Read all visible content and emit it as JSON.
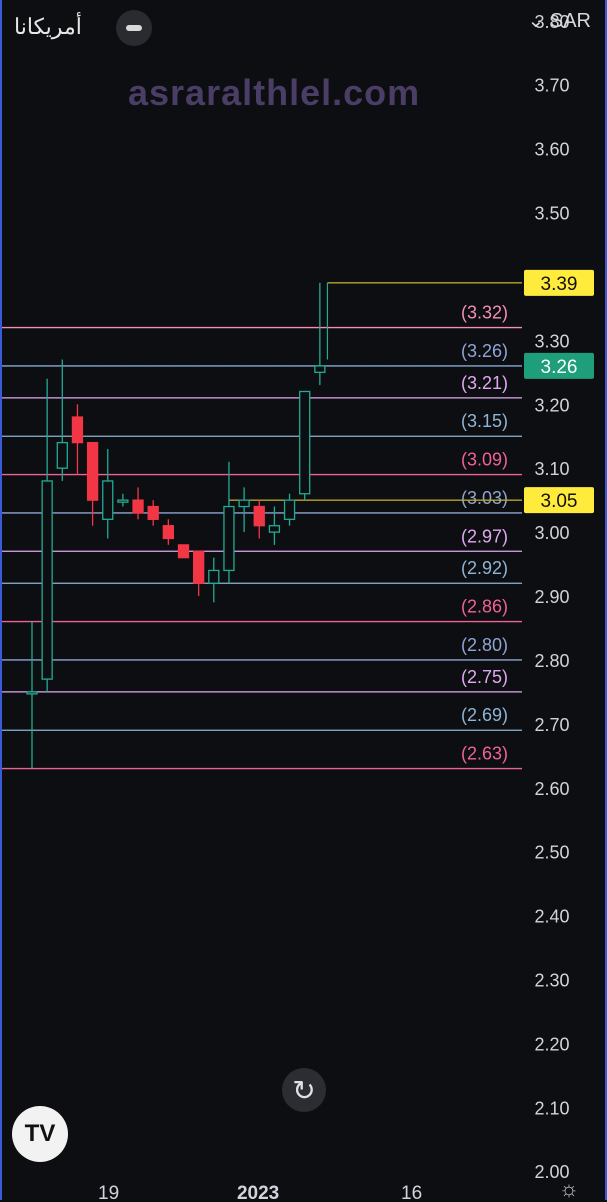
{
  "header": {
    "title": "أمريكانا",
    "currency": "SAR",
    "currency_chevron": "⌄",
    "watermark": "asraralthlel.com"
  },
  "icons": {
    "collapse": "minus-icon",
    "reset": "reset-icon",
    "logo": "tradingview-logo",
    "settings": "settings-icon"
  },
  "logo_text": "TV",
  "reset_glyph": "↻",
  "settings_glyph": "☼",
  "chart_data": {
    "type": "candlestick",
    "y_ticks": [
      "3.80",
      "3.70",
      "3.60",
      "3.50",
      "3.30",
      "3.20",
      "3.10",
      "3.00",
      "2.90",
      "2.80",
      "2.70",
      "2.60",
      "2.50",
      "2.40",
      "2.30",
      "2.20",
      "2.10",
      "2.00"
    ],
    "ylim": [
      1.955,
      3.82
    ],
    "x_labels": [
      {
        "label": "19",
        "index": 4
      },
      {
        "label": "2023",
        "index": 14
      },
      {
        "label": "16",
        "index": 24
      }
    ],
    "candles": [
      {
        "o": 2.75,
        "h": 2.86,
        "l": 2.63,
        "c": 2.75
      },
      {
        "o": 2.77,
        "h": 3.24,
        "l": 2.75,
        "c": 3.08
      },
      {
        "o": 3.1,
        "h": 3.27,
        "l": 3.08,
        "c": 3.14
      },
      {
        "o": 3.18,
        "h": 3.2,
        "l": 3.09,
        "c": 3.14
      },
      {
        "o": 3.14,
        "h": 3.14,
        "l": 3.01,
        "c": 3.05
      },
      {
        "o": 3.02,
        "h": 3.13,
        "l": 2.99,
        "c": 3.08
      },
      {
        "o": 3.05,
        "h": 3.06,
        "l": 3.04,
        "c": 3.05
      },
      {
        "o": 3.05,
        "h": 3.07,
        "l": 3.02,
        "c": 3.03
      },
      {
        "o": 3.04,
        "h": 3.05,
        "l": 3.01,
        "c": 3.02
      },
      {
        "o": 3.01,
        "h": 3.02,
        "l": 2.98,
        "c": 2.99
      },
      {
        "o": 2.98,
        "h": 2.98,
        "l": 2.96,
        "c": 2.96
      },
      {
        "o": 2.97,
        "h": 2.97,
        "l": 2.9,
        "c": 2.92
      },
      {
        "o": 2.92,
        "h": 2.96,
        "l": 2.89,
        "c": 2.94
      },
      {
        "o": 2.94,
        "h": 3.11,
        "l": 2.92,
        "c": 3.04
      },
      {
        "o": 3.04,
        "h": 3.07,
        "l": 3.0,
        "c": 3.05
      },
      {
        "o": 3.04,
        "h": 3.05,
        "l": 2.99,
        "c": 3.01
      },
      {
        "o": 3.0,
        "h": 3.04,
        "l": 2.98,
        "c": 3.01
      },
      {
        "o": 3.02,
        "h": 3.06,
        "l": 3.01,
        "c": 3.05
      },
      {
        "o": 3.06,
        "h": 3.22,
        "l": 3.05,
        "c": 3.22
      },
      {
        "o": 3.25,
        "h": 3.39,
        "l": 3.23,
        "c": 3.26
      }
    ],
    "levels": [
      {
        "label": "(3.32)",
        "value": 3.32,
        "color": "#f48fb1"
      },
      {
        "label": "(3.26)",
        "value": 3.26,
        "color": "#90a4d4"
      },
      {
        "label": "(3.21)",
        "value": 3.21,
        "color": "#e1a8f0"
      },
      {
        "label": "(3.15)",
        "value": 3.15,
        "color": "#90b4d4"
      },
      {
        "label": "(3.09)",
        "value": 3.09,
        "color": "#f06292"
      },
      {
        "label": "(3.03)",
        "value": 3.03,
        "color": "#90a4d4"
      },
      {
        "label": "(2.97)",
        "value": 2.97,
        "color": "#e1a8f0"
      },
      {
        "label": "(2.92)",
        "value": 2.92,
        "color": "#90b4d4"
      },
      {
        "label": "(2.86)",
        "value": 2.86,
        "color": "#f06292"
      },
      {
        "label": "(2.80)",
        "value": 2.8,
        "color": "#90a4d4"
      },
      {
        "label": "(2.75)",
        "value": 2.75,
        "color": "#e1a8f0"
      },
      {
        "label": "(2.69)",
        "value": 2.69,
        "color": "#90b4d4"
      },
      {
        "label": "(2.63)",
        "value": 2.63,
        "color": "#f06292"
      }
    ],
    "markers": [
      {
        "label": "3.39",
        "value": 3.39,
        "bg": "#ffeb3b",
        "fg": "#111111",
        "line_from_index": 19.5,
        "line_color": "#b5a62a"
      },
      {
        "label": "3.26",
        "value": 3.26,
        "bg": "#1e9e7a",
        "fg": "#ffffff",
        "dotted": true
      },
      {
        "label": "3.05",
        "value": 3.05,
        "bg": "#ffeb3b",
        "fg": "#111111",
        "line_from_index": 13.0,
        "line_color": "#b5a62a"
      }
    ],
    "colors": {
      "up": "#22ab94",
      "down": "#f23645",
      "background": "#0d0e12",
      "axis_text": "#d1d4dc",
      "current_price_line": "#5fb8c4"
    }
  }
}
